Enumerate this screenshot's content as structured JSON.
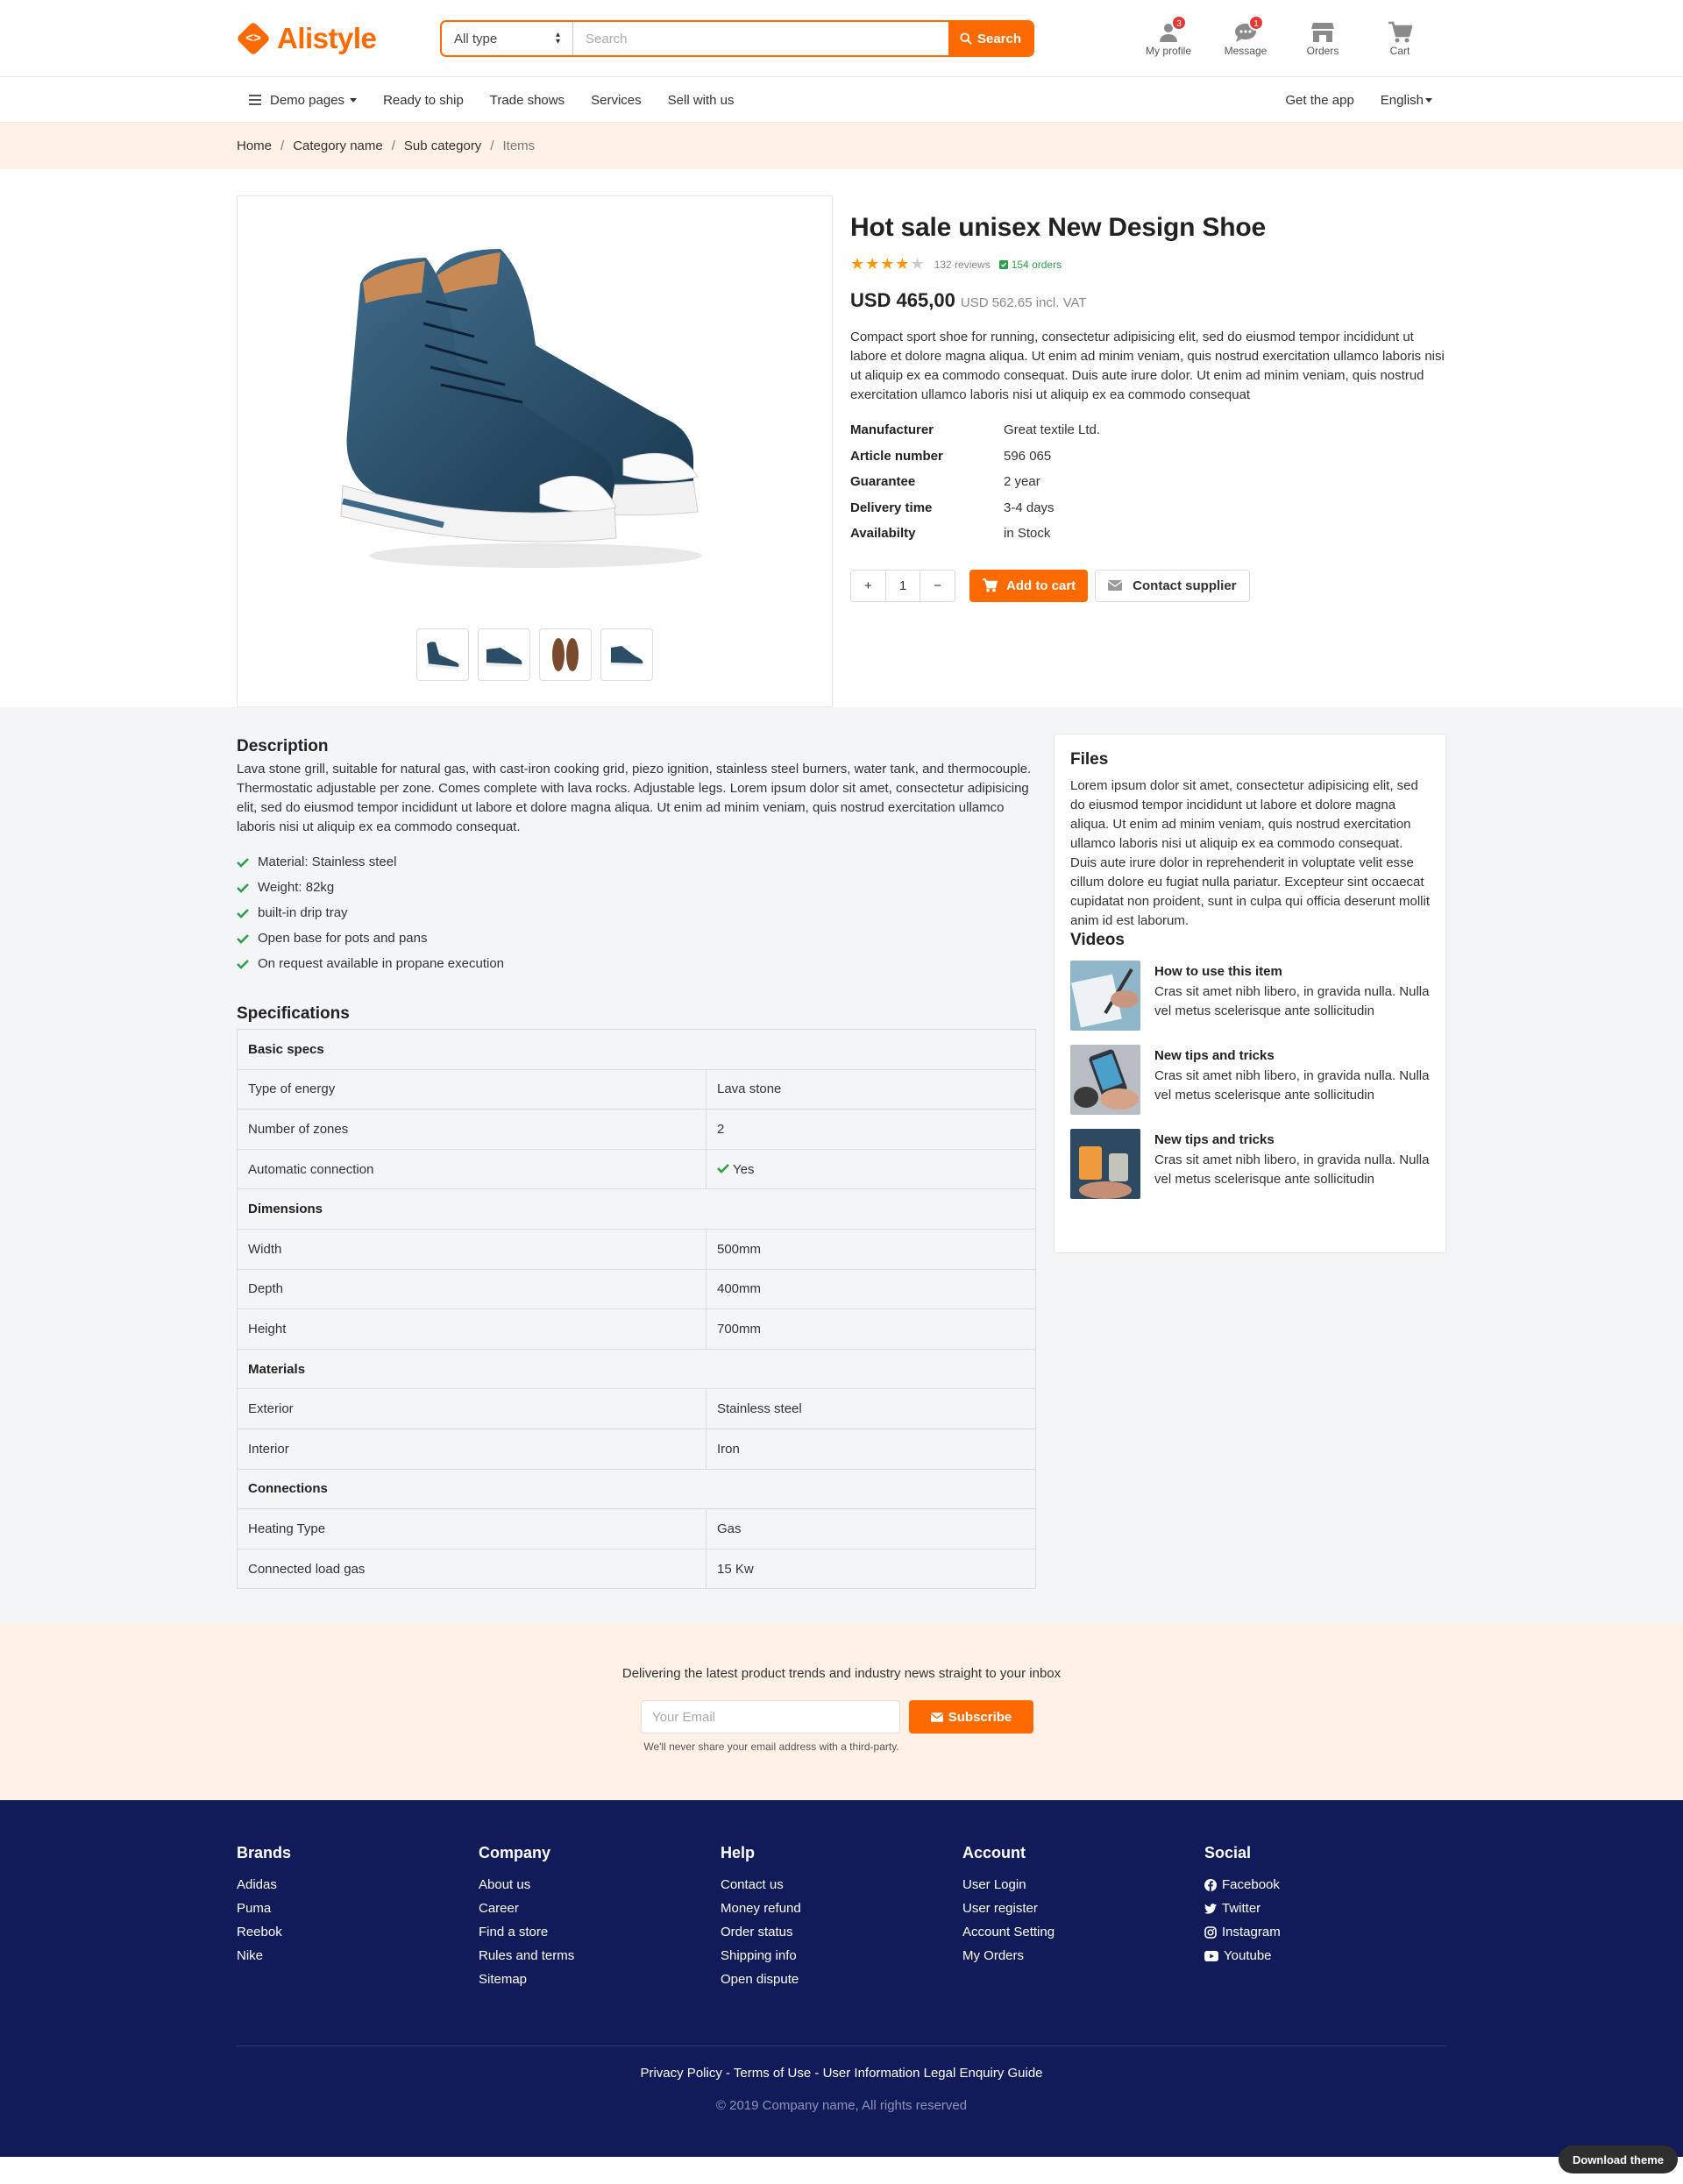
{
  "brand": {
    "name": "Alistyle",
    "mark": "<>"
  },
  "colors": {
    "accent": "#ff6a00",
    "footer_bg": "#121b5a",
    "breadcrumb_bg": "#fff1e6",
    "section_bg": "#f4f5f7",
    "check": "#2e9e4a"
  },
  "search": {
    "category": "All type",
    "placeholder": "Search",
    "button": "Search"
  },
  "header_icons": [
    {
      "icon": "user-icon",
      "label": "My profile",
      "badge": "3"
    },
    {
      "icon": "message-icon",
      "label": "Message",
      "badge": "1"
    },
    {
      "icon": "store-icon",
      "label": "Orders"
    },
    {
      "icon": "cart-icon",
      "label": "Cart"
    }
  ],
  "nav": {
    "items": [
      "Demo pages",
      "Ready to ship",
      "Trade shows",
      "Services",
      "Sell with us"
    ],
    "right": [
      "Get the app",
      "English"
    ]
  },
  "breadcrumb": [
    "Home",
    "Category name",
    "Sub category",
    "Items"
  ],
  "product": {
    "title": "Hot sale unisex New Design Shoe",
    "rating": 4,
    "reviews": "132 reviews",
    "orders": "154 orders",
    "price": "USD 465,00",
    "price_vat": "USD 562.65 incl. VAT",
    "description": "Compact sport shoe for running, consectetur adipisicing elit, sed do eiusmod tempor incididunt ut labore et dolore magna aliqua. Ut enim ad minim veniam, quis nostrud exercitation ullamco laboris nisi ut aliquip ex ea commodo consequat. Duis aute irure dolor. Ut enim ad minim veniam, quis nostrud exercitation ullamco laboris nisi ut aliquip ex ea commodo consequat",
    "details": [
      {
        "k": "Manufacturer",
        "v": "Great textile Ltd."
      },
      {
        "k": "Article number",
        "v": "596 065"
      },
      {
        "k": "Guarantee",
        "v": "2 year"
      },
      {
        "k": "Delivery time",
        "v": "3-4 days"
      },
      {
        "k": "Availabilty",
        "v": "in Stock"
      }
    ],
    "qty": {
      "plus": "+",
      "value": "1",
      "minus": "−"
    },
    "add_to_cart": "Add to cart",
    "contact": "Contact supplier"
  },
  "description": {
    "title": "Description",
    "text": "Lava stone grill, suitable for natural gas, with cast-iron cooking grid, piezo ignition, stainless steel burners, water tank, and thermocouple. Thermostatic adjustable per zone. Comes complete with lava rocks. Adjustable legs. Lorem ipsum dolor sit amet, consectetur adipisicing elit, sed do eiusmod tempor incididunt ut labore et dolore magna aliqua. Ut enim ad minim veniam, quis nostrud exercitation ullamco laboris nisi ut aliquip ex ea commodo consequat.",
    "features": [
      "Material: Stainless steel",
      "Weight: 82kg",
      "built-in drip tray",
      "Open base for pots and pans",
      "On request available in propane execution"
    ]
  },
  "specifications": {
    "title": "Specifications",
    "groups": [
      {
        "name": "Basic specs",
        "rows": [
          [
            "Type of energy",
            "Lava stone"
          ],
          [
            "Number of zones",
            "2"
          ],
          [
            "Automatic connection",
            "Yes"
          ]
        ]
      },
      {
        "name": "Dimensions",
        "rows": [
          [
            "Width",
            "500mm"
          ],
          [
            "Depth",
            "400mm"
          ],
          [
            "Height",
            "700mm"
          ]
        ]
      },
      {
        "name": "Materials",
        "rows": [
          [
            "Exterior",
            "Stainless steel"
          ],
          [
            "Interior",
            "Iron"
          ]
        ]
      },
      {
        "name": "Connections",
        "rows": [
          [
            "Heating Type",
            "Gas"
          ],
          [
            "Connected load gas",
            "15 Kw"
          ]
        ]
      }
    ]
  },
  "files": {
    "title": "Files",
    "text": "Lorem ipsum dolor sit amet, consectetur adipisicing elit, sed do eiusmod tempor incididunt ut labore et dolore magna aliqua. Ut enim ad minim veniam, quis nostrud exercitation ullamco laboris nisi ut aliquip ex ea commodo consequat. Duis aute irure dolor in reprehenderit in voluptate velit esse cillum dolore eu fugiat nulla pariatur. Excepteur sint occaecat cupidatat non proident, sunt in culpa qui officia deserunt mollit anim id est laborum."
  },
  "videos": {
    "title": "Videos",
    "items": [
      {
        "title": "How to use this item",
        "text": "Cras sit amet nibh libero, in gravida nulla. Nulla vel metus scelerisque ante sollicitudin"
      },
      {
        "title": "New tips and tricks",
        "text": "Cras sit amet nibh libero, in gravida nulla. Nulla vel metus scelerisque ante sollicitudin"
      },
      {
        "title": "New tips and tricks",
        "text": "Cras sit amet nibh libero, in gravida nulla. Nulla vel metus scelerisque ante sollicitudin"
      }
    ]
  },
  "subscribe": {
    "lead": "Delivering the latest product trends and industry news straight to your inbox",
    "placeholder": "Your Email",
    "button": "Subscribe",
    "note": "We'll never share your email address with a third-party."
  },
  "footer": {
    "columns": [
      {
        "title": "Brands",
        "links": [
          "Adidas",
          "Puma",
          "Reebok",
          "Nike"
        ]
      },
      {
        "title": "Company",
        "links": [
          "About us",
          "Career",
          "Find a store",
          "Rules and terms",
          "Sitemap"
        ]
      },
      {
        "title": "Help",
        "links": [
          "Contact us",
          "Money refund",
          "Order status",
          "Shipping info",
          "Open dispute"
        ]
      },
      {
        "title": "Account",
        "links": [
          "User Login",
          "User register",
          "Account Setting",
          "My Orders"
        ]
      },
      {
        "title": "Social",
        "links": [
          "Facebook",
          "Twitter",
          "Instagram",
          "Youtube"
        ]
      }
    ],
    "legal": "Privacy Policy - Terms of Use - User Information Legal Enquiry Guide",
    "copyright": "© 2019 Company name, All rights reserved"
  },
  "download_theme": "Download theme"
}
